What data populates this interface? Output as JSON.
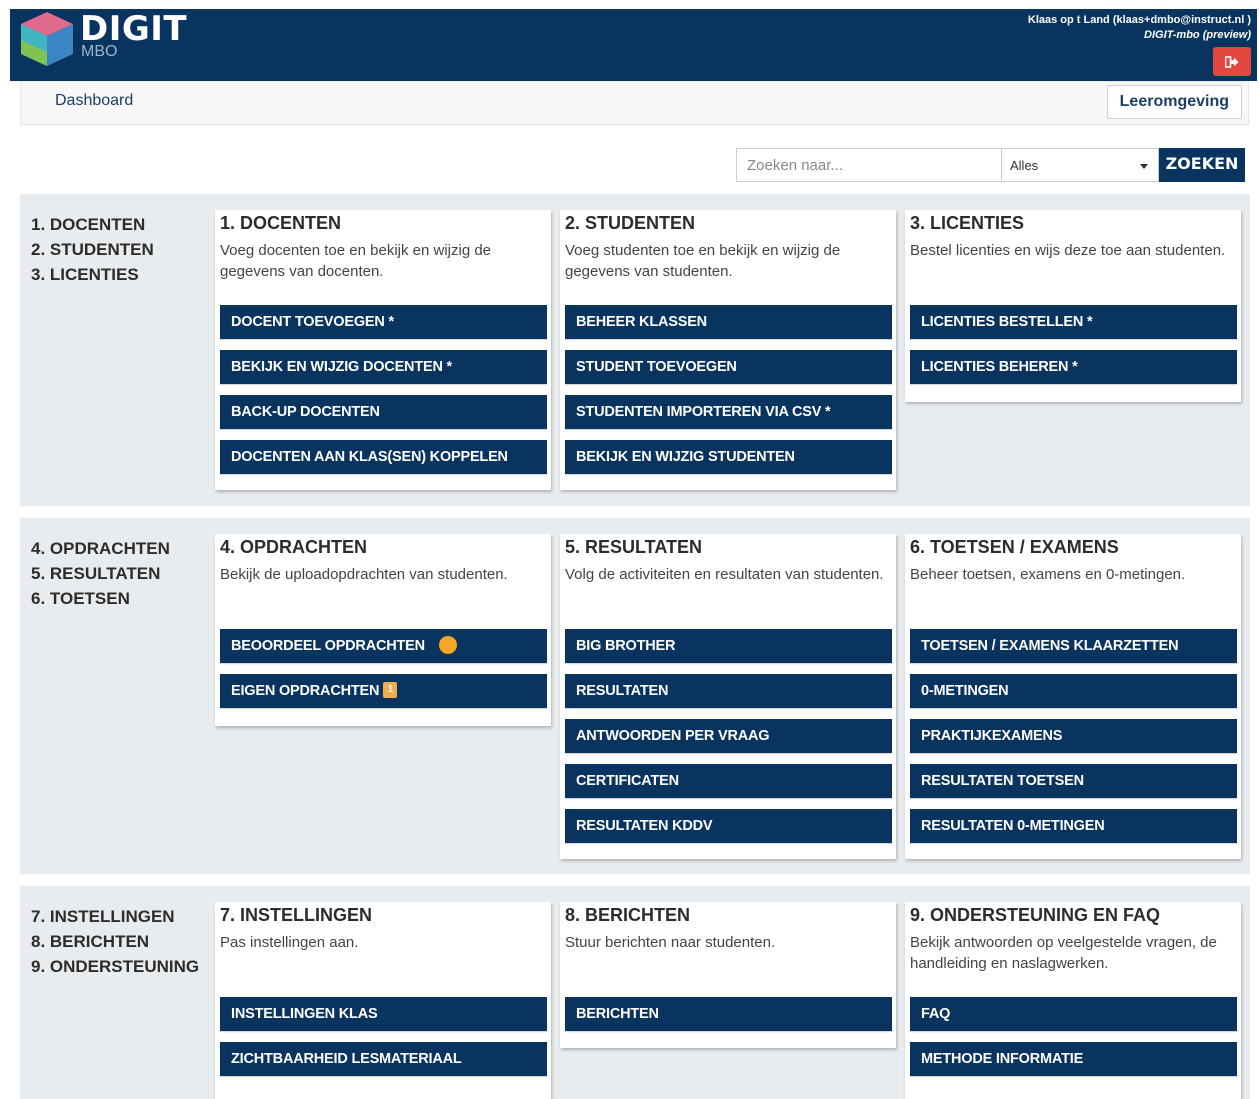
{
  "header": {
    "logo_title": "DIGIT",
    "logo_sub": "MBO",
    "user_name": "Klaas op t Land (klaas+dmbo@instruct.nl )",
    "user_context": "DIGIT-mbo (preview)",
    "logout_icon": "sign-out-icon",
    "logout_color": "#e2483e",
    "brand_color": "#0a3460"
  },
  "nav": {
    "dashboard": "Dashboard",
    "leeromgeving": "Leeromgeving"
  },
  "search": {
    "placeholder": "Zoeken naar...",
    "scope": "Alles",
    "button": "ZOEKEN"
  },
  "sections": [
    {
      "side": [
        "1. DOCENTEN",
        "2. STUDENTEN",
        "3. LICENTIES"
      ],
      "cards": [
        {
          "title": "1. DOCENTEN",
          "desc": "Voeg docenten toe en bekijk en wijzig de gegevens van docenten.",
          "buttons": [
            "DOCENT TOEVOEGEN *",
            "BEKIJK EN WIJZIG DOCENTEN *",
            "BACK-UP DOCENTEN",
            "DOCENTEN AAN KLAS(SEN) KOPPELEN"
          ]
        },
        {
          "title": "2. STUDENTEN",
          "desc": "Voeg studenten toe en bekijk en wijzig de gegevens van studenten.",
          "buttons": [
            "BEHEER KLASSEN",
            "STUDENT TOEVOEGEN",
            "STUDENTEN IMPORTEREN VIA CSV *",
            "BEKIJK EN WIJZIG STUDENTEN"
          ]
        },
        {
          "title": "3. LICENTIES",
          "desc": "Bestel licenties en wijs deze toe aan studenten.",
          "buttons": [
            "LICENTIES BESTELLEN *",
            "LICENTIES BEHEREN *"
          ]
        }
      ]
    },
    {
      "side": [
        "4. OPDRACHTEN",
        "5. RESULTATEN",
        "6. TOETSEN"
      ],
      "cards": [
        {
          "title": "4. OPDRACHTEN",
          "desc": "Bekijk de uploadopdrachten van studenten.",
          "buttons": [
            "BEOORDEEL OPDRACHTEN",
            "EIGEN OPDRACHTEN"
          ],
          "badge": "1"
        },
        {
          "title": "5. RESULTATEN",
          "desc": "Volg de activiteiten en resultaten van studenten.",
          "buttons": [
            "BIG BROTHER",
            "RESULTATEN",
            "ANTWOORDEN PER VRAAG",
            "CERTIFICATEN",
            "RESULTATEN KDDV"
          ]
        },
        {
          "title": "6. TOETSEN / EXAMENS",
          "desc": "Beheer toetsen, examens en 0-metingen.",
          "buttons": [
            "TOETSEN / EXAMENS KLAARZETTEN",
            "0-METINGEN",
            "PRAKTIJKEXAMENS",
            "RESULTATEN TOETSEN",
            "RESULTATEN 0-METINGEN"
          ]
        }
      ]
    },
    {
      "side": [
        "7. INSTELLINGEN",
        "8. BERICHTEN",
        "9. ONDERSTEUNING"
      ],
      "cards": [
        {
          "title": "7. INSTELLINGEN",
          "desc": "Pas instellingen aan.",
          "buttons": [
            "INSTELLINGEN KLAS",
            "ZICHTBAARHEID LESMATERIAAL"
          ]
        },
        {
          "title": "8. BERICHTEN",
          "desc": "Stuur berichten naar studenten.",
          "buttons": [
            "BERICHTEN"
          ]
        },
        {
          "title": "9. ONDERSTEUNING EN FAQ",
          "desc": "Bekijk antwoorden op veelgestelde vragen, de handleiding en naslagwerken.",
          "buttons": [
            "FAQ",
            "METHODE INFORMATIE"
          ]
        }
      ]
    }
  ]
}
